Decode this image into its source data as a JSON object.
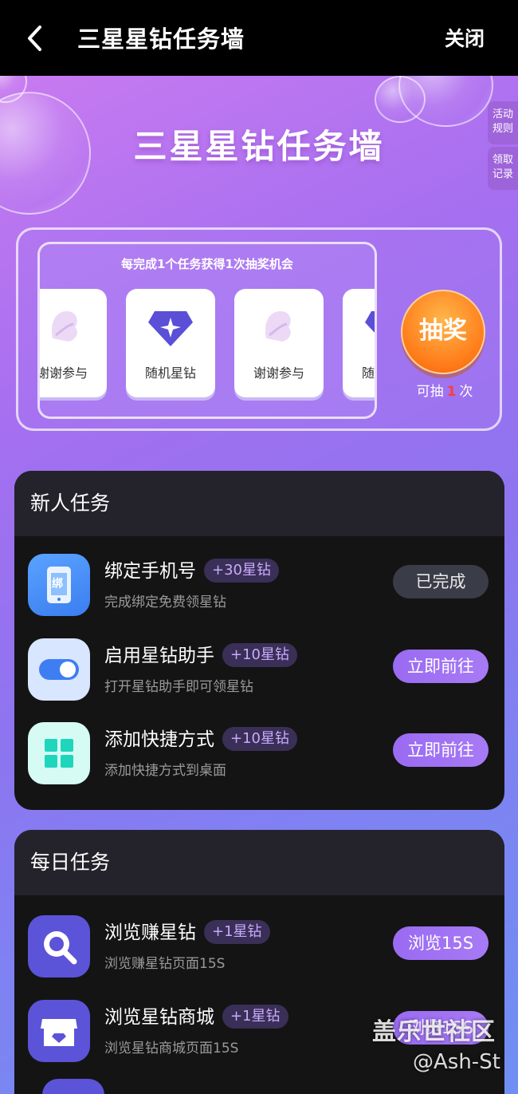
{
  "header": {
    "title": "三星星钻任务墙",
    "close_label": "关闭"
  },
  "hero": {
    "title": "三星星钻任务墙"
  },
  "side_tabs": [
    {
      "label_line1": "活动",
      "label_line2": "规则"
    },
    {
      "label_line1": "领取",
      "label_line2": "记录"
    }
  ],
  "lottery": {
    "caption": "每完成1个任务获得1次抽奖机会",
    "prizes": [
      {
        "label": "谢谢参与",
        "icon": "thanks-icon"
      },
      {
        "label": "随机星钻",
        "icon": "star-diamond-icon"
      },
      {
        "label": "谢谢参与",
        "icon": "thanks-icon"
      },
      {
        "label": "随机星钻",
        "icon": "star-diamond-icon"
      }
    ],
    "draw_button": "抽奖",
    "count_prefix": "可抽",
    "count": "1",
    "count_suffix": "次"
  },
  "newbie": {
    "title": "新人任务",
    "tasks": [
      {
        "name": "绑定手机号",
        "reward": "+30星钻",
        "desc": "完成绑定免费领星钻",
        "button": "已完成",
        "icon": "phone-bind-icon",
        "icon_text": "绑"
      },
      {
        "name": "启用星钻助手",
        "reward": "+10星钻",
        "desc": "打开星钻助手即可领星钻",
        "button": "立即前往",
        "icon": "toggle-icon"
      },
      {
        "name": "添加快捷方式",
        "reward": "+10星钻",
        "desc": "添加快捷方式到桌面",
        "button": "立即前往",
        "icon": "grid-icon"
      }
    ]
  },
  "daily": {
    "title": "每日任务",
    "tasks": [
      {
        "name": "浏览赚星钻",
        "reward": "+1星钻",
        "desc": "浏览赚星钻页面15S",
        "button": "浏览15S",
        "icon": "browse-search-icon"
      },
      {
        "name": "浏览星钻商城",
        "reward": "+1星钻",
        "desc": "浏览星钻商城页面15S",
        "button": "浏览15S",
        "icon": "store-icon"
      }
    ]
  },
  "watermark": {
    "line1": "盖乐世社区",
    "line2": "@Ash-St"
  },
  "colors": {
    "accent": "#9a6bf2",
    "badge_text": "#c9aaff",
    "count_red": "#ff3b3b"
  }
}
